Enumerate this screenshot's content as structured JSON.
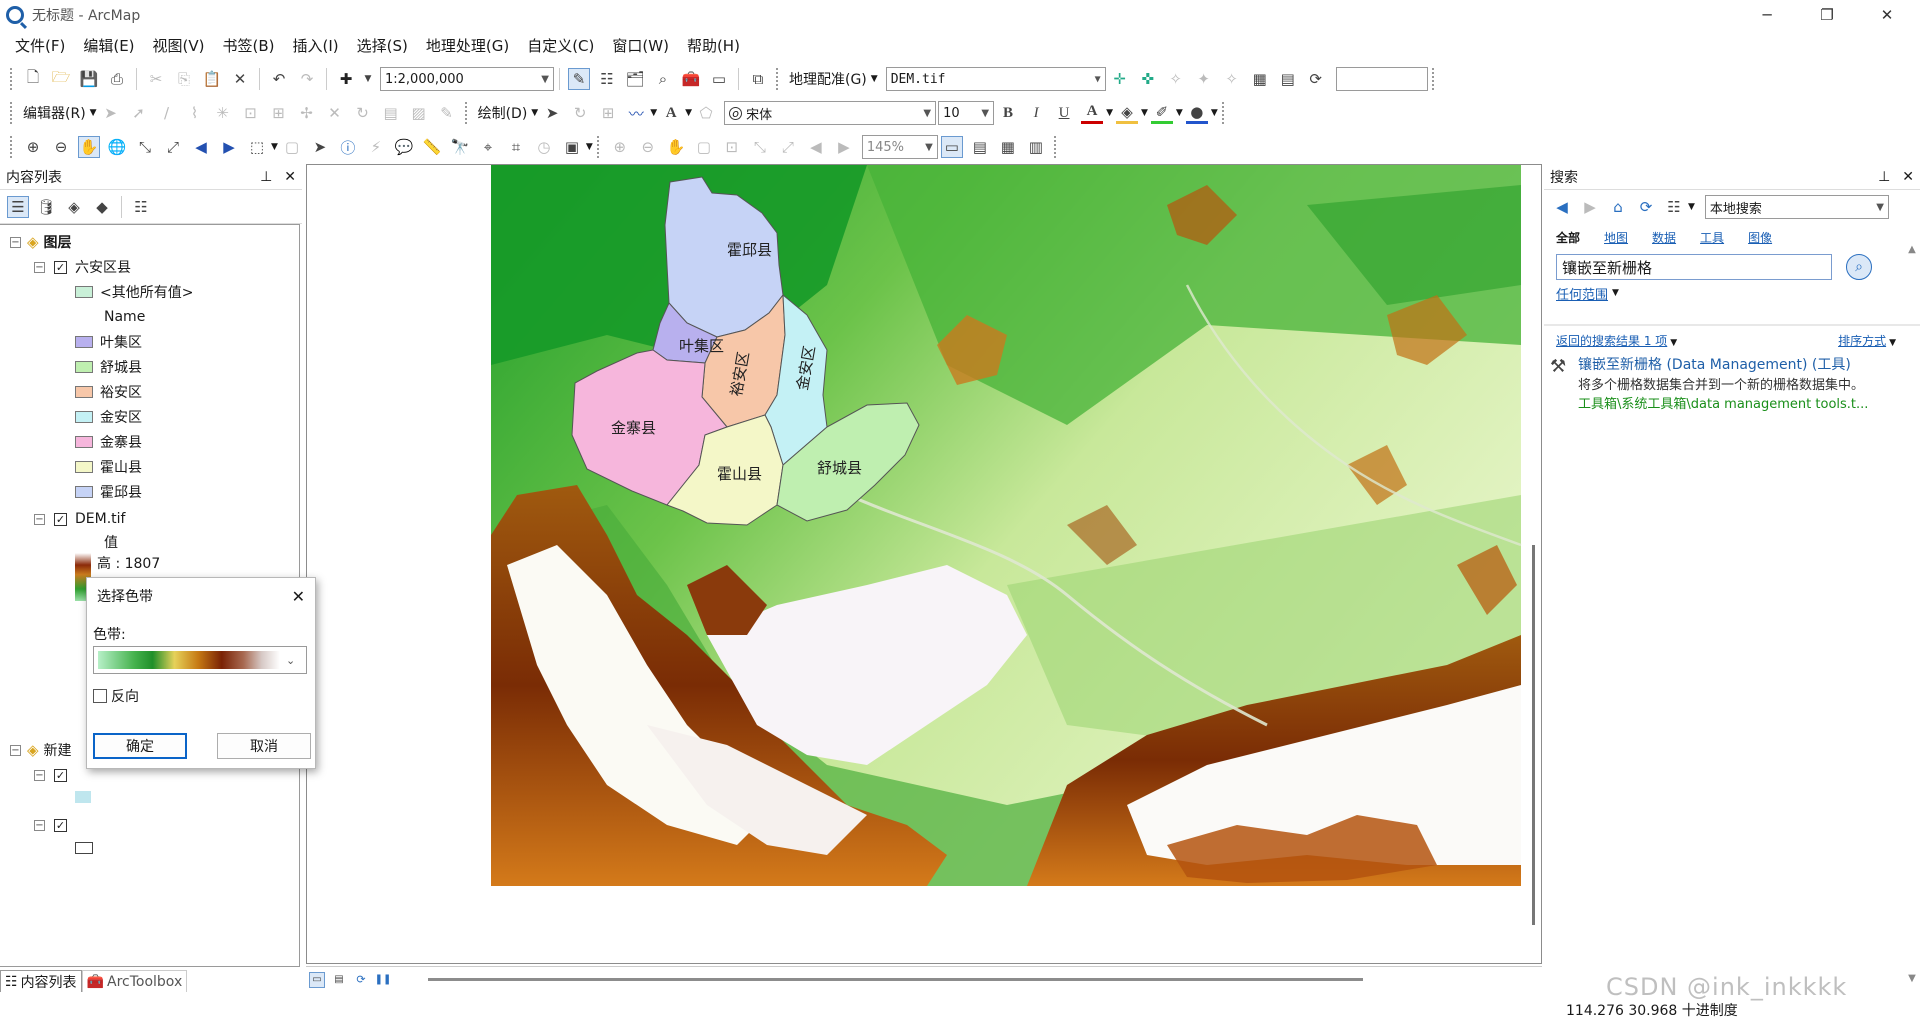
{
  "window": {
    "title": "无标题 - ArcMap",
    "minimize": "─",
    "restore": "❐",
    "close": "✕"
  },
  "menu": [
    "文件(F)",
    "编辑(E)",
    "视图(V)",
    "书签(B)",
    "插入(I)",
    "选择(S)",
    "地理处理(G)",
    "自定义(C)",
    "窗口(W)",
    "帮助(H)"
  ],
  "toolbar1": {
    "scale": "1:2,000,000",
    "georef_label": "地理配准(G)",
    "georef_layer": "DEM.tif"
  },
  "toolbar2": {
    "editor_label": "编辑器(R)",
    "draw_label": "绘制(D)",
    "font": "宋体",
    "font_size": "10",
    "bold": "B",
    "italic": "I",
    "underline": "U",
    "text_tool": "A"
  },
  "toolbar3": {
    "zoom": "145%"
  },
  "toc": {
    "title": "内容列表",
    "layers_root": "图层",
    "layer1": {
      "name": "六安区县",
      "other": "<其他所有值>",
      "field": "Name",
      "classes": [
        {
          "label": "叶集区",
          "color": "#b8b0ee"
        },
        {
          "label": "舒城县",
          "color": "#bfefb0"
        },
        {
          "label": "裕安区",
          "color": "#f7c7a9"
        },
        {
          "label": "金安区",
          "color": "#c4f1f5"
        },
        {
          "label": "金寨县",
          "color": "#f6b6dc"
        },
        {
          "label": "霍山县",
          "color": "#f4f7c8"
        },
        {
          "label": "霍邱县",
          "color": "#c6d3f6"
        }
      ],
      "other_color": "#c9f0d8"
    },
    "layer2": {
      "name": "DEM.tif",
      "value_label": "值",
      "high_label": "高 : 1807"
    },
    "frame2_label": "新建",
    "tabs": [
      "内容列表",
      "ArcToolbox"
    ]
  },
  "dialog": {
    "title": "选择色带",
    "ramp_label": "色带:",
    "reverse_label": "反向",
    "ok": "确定",
    "cancel": "取消"
  },
  "map_labels": [
    "霍邱县",
    "叶集区",
    "裕安区",
    "金安区",
    "金寨县",
    "霍山县",
    "舒城县"
  ],
  "search": {
    "title": "搜索",
    "scope": "本地搜索",
    "filters": [
      "全部",
      "地图",
      "数据",
      "工具",
      "图像"
    ],
    "query": "镶嵌至新栅格",
    "extent": "任何范围",
    "results_count": "返回的搜索结果 1 项",
    "sort": "排序方式",
    "result": {
      "title": "镶嵌至新栅格 (Data Management) (工具)",
      "desc": "将多个栅格数据集合并到一个新的栅格数据集中。",
      "path": "工具箱\\系统工具箱\\data management tools.t..."
    }
  },
  "status": {
    "coords": "114.276  30.968 十进制度",
    "watermark": "CSDN @ink_inkkkk"
  },
  "colors": {
    "accent": "#1a5fb4",
    "result_path": "#1a8f1a",
    "title_blue": "#1f5fa8"
  }
}
